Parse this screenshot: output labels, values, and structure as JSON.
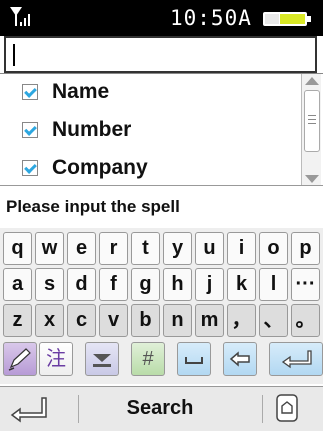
{
  "status": {
    "time": "10:50A",
    "signal_icon": "signal-icon",
    "battery_icon": "battery-icon"
  },
  "input": {
    "value": ""
  },
  "list": {
    "items": [
      {
        "label": "Name",
        "checked": true
      },
      {
        "label": "Number",
        "checked": true
      },
      {
        "label": "Company",
        "checked": true
      }
    ]
  },
  "prompt": "Please input the spell",
  "keyboard": {
    "row1": [
      "q",
      "w",
      "e",
      "r",
      "t",
      "y",
      "u",
      "i",
      "o",
      "p"
    ],
    "row2": [
      "a",
      "s",
      "d",
      "f",
      "g",
      "h",
      "j",
      "k",
      "l",
      "···"
    ],
    "row3": [
      "z",
      "x",
      "c",
      "v",
      "b",
      "n",
      "m",
      "，",
      "、",
      "。"
    ],
    "fn": [
      "pen-icon",
      "注",
      "mail-icon",
      "#",
      "space-icon",
      "backspace-icon",
      "enter-icon"
    ]
  },
  "softkeys": {
    "left_icon": "back-icon",
    "middle": "Search",
    "right_icon": "home-icon"
  }
}
